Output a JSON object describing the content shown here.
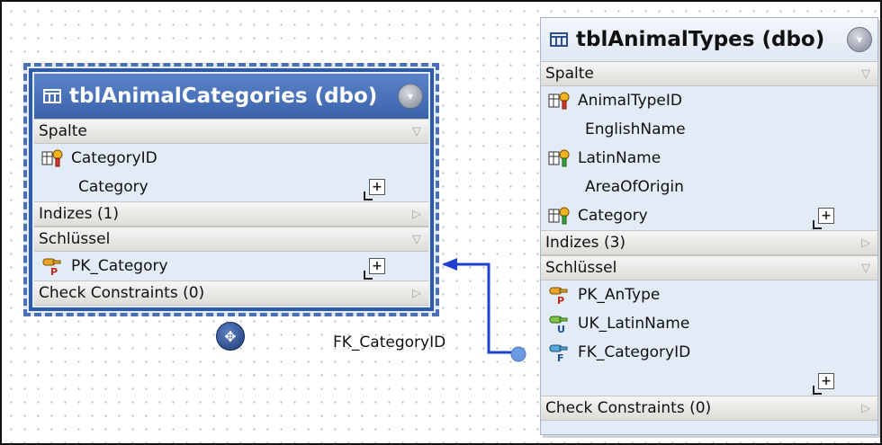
{
  "relation": {
    "label": "FK_CategoryID"
  },
  "tables": [
    {
      "title": "tblAnimalCategories (dbo)",
      "columns_header": "Spalte",
      "columns": [
        {
          "name": "CategoryID",
          "icon": "key-column-icon"
        },
        {
          "name": "Category",
          "icon": ""
        }
      ],
      "indexes_header": "Indizes (1)",
      "keys_header": "Schlüssel",
      "keys": [
        {
          "name": "PK_Category",
          "icon": "primary-key-icon"
        }
      ],
      "check_constraints_header": "Check Constraints (0)"
    },
    {
      "title": "tblAnimalTypes (dbo)",
      "columns_header": "Spalte",
      "columns": [
        {
          "name": "AnimalTypeID",
          "icon": "key-column-icon"
        },
        {
          "name": "EnglishName",
          "icon": ""
        },
        {
          "name": "LatinName",
          "icon": "unique-column-icon"
        },
        {
          "name": "AreaOfOrigin",
          "icon": ""
        },
        {
          "name": "Category",
          "icon": "key-column-icon"
        }
      ],
      "indexes_header": "Indizes (3)",
      "keys_header": "Schlüssel",
      "keys": [
        {
          "name": "PK_AnType",
          "icon": "primary-key-icon"
        },
        {
          "name": "UK_LatinName",
          "icon": "unique-key-icon"
        },
        {
          "name": "FK_CategoryID",
          "icon": "foreign-key-icon"
        }
      ],
      "check_constraints_header": "Check Constraints (0)"
    }
  ],
  "colors": {
    "selection_border": "#2e5aa8",
    "relation_line": "#1f3fd0",
    "table_body": "#e3ebf6",
    "section_bar": "#dcdcd8"
  }
}
